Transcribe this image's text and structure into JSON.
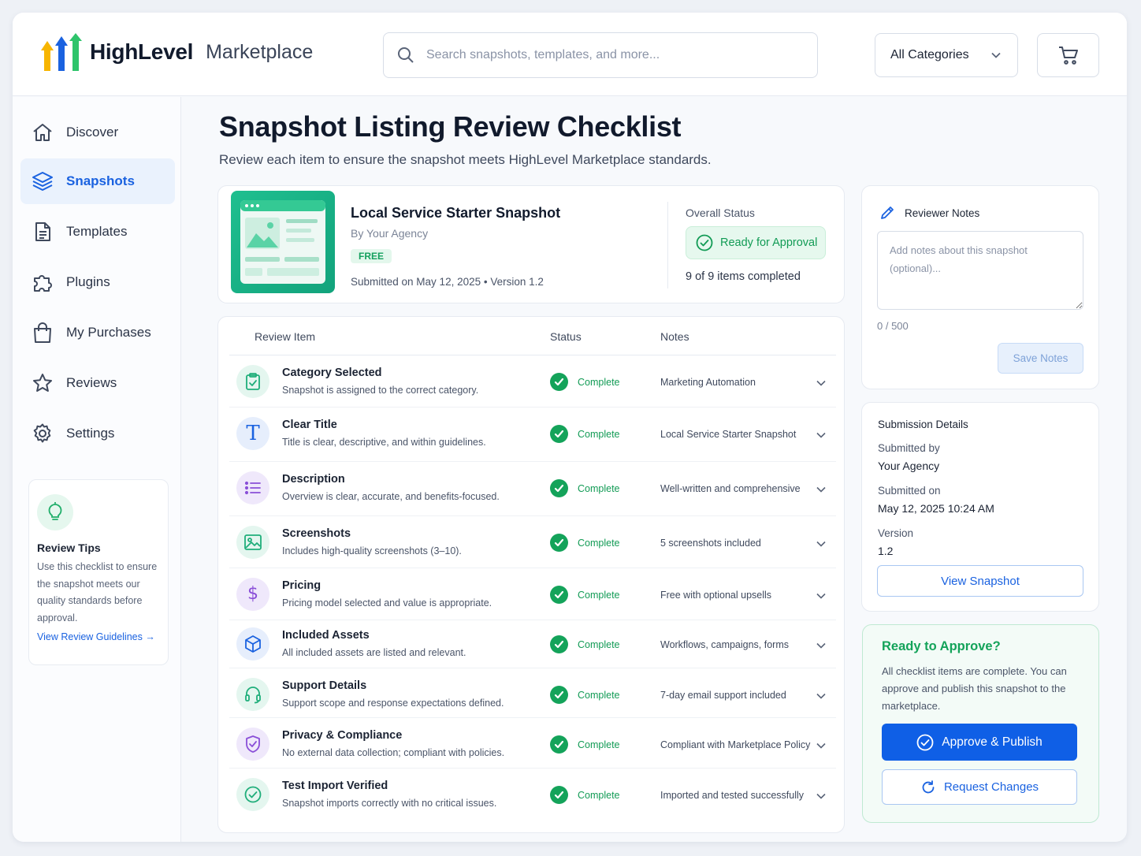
{
  "header": {
    "brand": "HighLevel",
    "brand_sub": "Marketplace",
    "search_placeholder": "Search snapshots, templates, and more...",
    "category": "All Categories"
  },
  "sidebar": {
    "items": [
      {
        "label": "Discover",
        "icon": "home-icon"
      },
      {
        "label": "Snapshots",
        "icon": "layers-icon",
        "active": true
      },
      {
        "label": "Templates",
        "icon": "document-icon"
      },
      {
        "label": "Plugins",
        "icon": "puzzle-icon"
      },
      {
        "label": "My Purchases",
        "icon": "shopping-bag-icon"
      },
      {
        "label": "Reviews",
        "icon": "star-icon"
      },
      {
        "label": "Settings",
        "icon": "gear-icon"
      }
    ],
    "tips": {
      "title": "Review Tips",
      "body": "Use this checklist to ensure the snapshot meets our quality standards before approval.",
      "link": "View Review Guidelines →"
    }
  },
  "page": {
    "title": "Snapshot Listing Review Checklist",
    "subtitle": "Review each item to ensure the snapshot meets HighLevel Marketplace standards."
  },
  "snapshot": {
    "name": "Local Service Starter Snapshot",
    "by": "By Your Agency",
    "price_badge": "FREE",
    "submitted_line": "Submitted on May 12, 2025  •  Version 1.2",
    "overall_label": "Overall Status",
    "overall_status": "Ready for Approval",
    "completed": "9 of 9 items completed"
  },
  "table": {
    "headers": {
      "item": "Review Item",
      "status": "Status",
      "notes": "Notes"
    },
    "rows": [
      {
        "title": "Category Selected",
        "desc": "Snapshot is assigned to the correct category.",
        "status": "Complete",
        "note": "Marketing Automation",
        "icon": "clipboard-icon"
      },
      {
        "title": "Clear Title",
        "desc": "Title is clear, descriptive, and within guidelines.",
        "status": "Complete",
        "note": "Local Service Starter Snapshot",
        "icon": "text-icon"
      },
      {
        "title": "Description",
        "desc": "Overview is clear, accurate, and benefits-focused.",
        "status": "Complete",
        "note": "Well-written and comprehensive",
        "icon": "list-icon"
      },
      {
        "title": "Screenshots",
        "desc": "Includes high-quality screenshots (3–10).",
        "status": "Complete",
        "note": "5 screenshots included",
        "icon": "image-icon"
      },
      {
        "title": "Pricing",
        "desc": "Pricing model selected and value is appropriate.",
        "status": "Complete",
        "note": "Free with optional upsells",
        "icon": "dollar-icon"
      },
      {
        "title": "Included Assets",
        "desc": "All included assets are listed and relevant.",
        "status": "Complete",
        "note": "Workflows, campaigns, forms",
        "icon": "box-icon"
      },
      {
        "title": "Support Details",
        "desc": "Support scope and response expectations defined.",
        "status": "Complete",
        "note": "7-day email support included",
        "icon": "headset-icon"
      },
      {
        "title": "Privacy & Compliance",
        "desc": "No external data collection; compliant with policies.",
        "status": "Complete",
        "note": "Compliant with Marketplace Policy",
        "icon": "shield-icon"
      },
      {
        "title": "Test Import Verified",
        "desc": "Snapshot imports correctly with no critical issues.",
        "status": "Complete",
        "note": "Imported and tested successfully",
        "icon": "check-circle-icon"
      }
    ]
  },
  "notes": {
    "title": "Reviewer Notes",
    "placeholder": "Add notes about this snapshot (optional)...",
    "count": "0 / 500",
    "save": "Save Notes"
  },
  "details": {
    "title": "Submission Details",
    "submitted_by_label": "Submitted by",
    "submitted_by": "Your Agency",
    "submitted_on_label": "Submitted on",
    "submitted_on": "May 12, 2025 10:24 AM",
    "version_label": "Version",
    "version": "1.2",
    "view_button": "View Snapshot"
  },
  "approve": {
    "title": "Ready to Approve?",
    "body": "All checklist items are complete. You can approve and publish this snapshot to the marketplace.",
    "primary": "Approve & Publish",
    "secondary": "Request Changes"
  },
  "colors": {
    "primary": "#0f5fe6",
    "success": "#14a35a",
    "active_nav_bg": "#eaf2fd"
  }
}
